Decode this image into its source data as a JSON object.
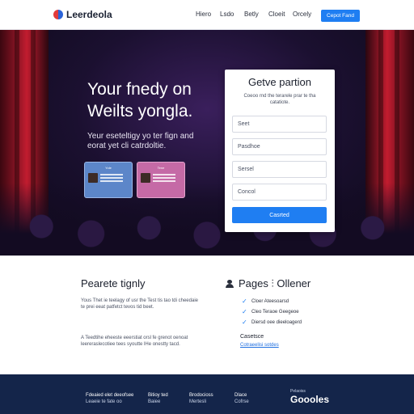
{
  "nav": {
    "logo_text": "Leerdeola",
    "links": [
      "Hiero",
      "Lsdo",
      "Betly",
      "Cloeit",
      "Orcely"
    ],
    "cta_label": "Cepot Fand"
  },
  "hero": {
    "title": "Your fnedy on Weilts yongla.",
    "subtitle": "Yeur eseteltigy yo ter fign and eorat yet cli catrdoltie.",
    "cards": [
      {
        "heading": "Yole"
      },
      {
        "heading": "Tene"
      }
    ]
  },
  "form": {
    "title": "Getve partion",
    "subtitle": "Coeoo rnd the terarele prar te tha catatiote.",
    "fields": [
      "Seet",
      "Pasdhoe",
      "Sersel",
      "Concol"
    ],
    "submit_label": "Casrted"
  },
  "features": {
    "left_title": "Pearete tignly",
    "left_text_1": "Yous Thet ie teelagy of usr the Test tis tao tdi cheedaie te prei eeat patfetct tevos  tid beet.",
    "left_text_2": "A Teedtihe eheeste eeerstiat orsl fe grenot oenoat leereraslecotiee tees syoutte lHe onestty tacd.",
    "right_title": "Pages ⫶ Ollener",
    "checks": [
      "Cloer Ateesoarsd",
      "Cleo Teraoe Geegeoe",
      "Diersd oee dieeloagerd"
    ],
    "link_title": "Casetsce",
    "link_label": "Cotraeelisi sotdes"
  },
  "footer": {
    "columns": [
      {
        "head": "Fdeaied elet deeofsee",
        "body": "Leaeie te fate oo"
      },
      {
        "head": "Bitioy ted",
        "body": "Baiee"
      },
      {
        "head": "Brodocioss",
        "body": "Mertesli"
      },
      {
        "head": "Dlace",
        "body": "Cofrse"
      }
    ],
    "brand_small": "Pelaoiss",
    "brand_big": "Goooles"
  },
  "colors": {
    "accent": "#1f7ef2",
    "footer_bg": "#14254a",
    "curtain": "#c21c2f"
  }
}
